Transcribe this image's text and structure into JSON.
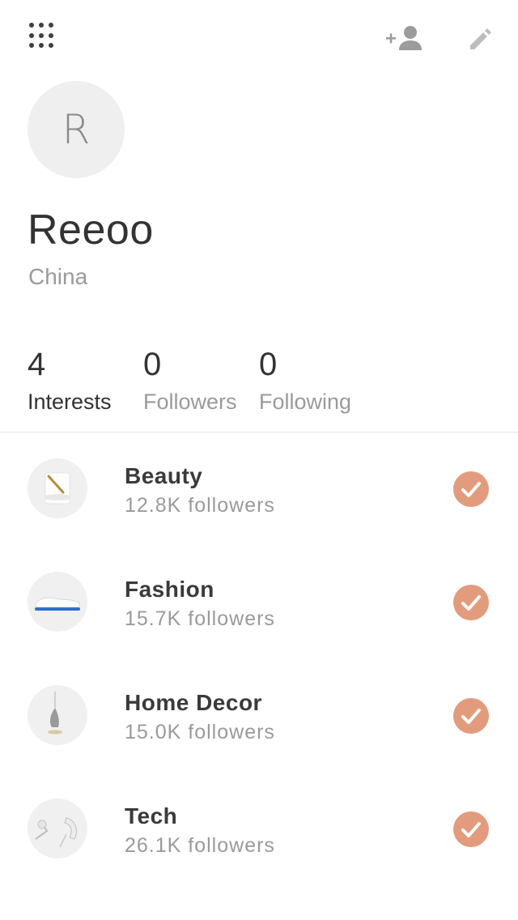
{
  "header": {
    "menu_icon": "grid-menu-icon",
    "add_user_icon": "add-user-icon",
    "edit_icon": "pencil-icon"
  },
  "profile": {
    "avatar_letter": "R",
    "name": "Reeoo",
    "location": "China"
  },
  "stats": [
    {
      "value": "4",
      "label": "Interests"
    },
    {
      "value": "0",
      "label": "Followers"
    },
    {
      "value": "0",
      "label": "Following"
    }
  ],
  "interests": [
    {
      "title": "Beauty",
      "followers": "12.8K followers",
      "thumb_icon": "candle-thumbnail"
    },
    {
      "title": "Fashion",
      "followers": "15.7K followers",
      "thumb_icon": "shoe-thumbnail"
    },
    {
      "title": "Home Decor",
      "followers": "15.0K followers",
      "thumb_icon": "pendant-lamp-thumbnail"
    },
    {
      "title": "Tech",
      "followers": "26.1K followers",
      "thumb_icon": "earphones-thumbnail"
    }
  ],
  "colors": {
    "check_accent": "#e29c7d",
    "muted_text": "#9a9a9a",
    "primary_text": "#333333"
  }
}
